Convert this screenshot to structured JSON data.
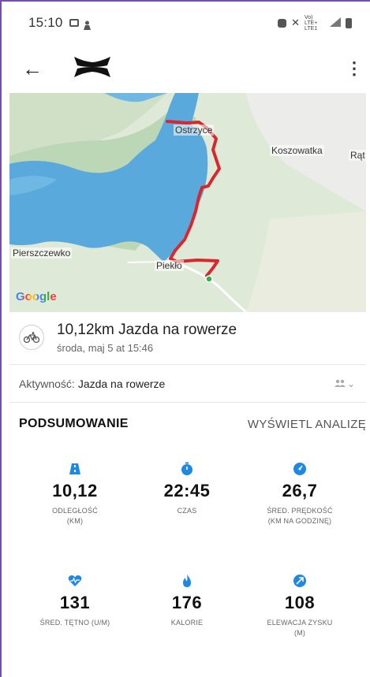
{
  "status_bar": {
    "time": "15:10",
    "network_label": "Vo) LTE+ LTE1"
  },
  "app_bar": {
    "back_glyph": "←",
    "menu_glyph": "⋮",
    "logo_name": "under-armour-logo"
  },
  "map": {
    "places": [
      "Ostrzyce",
      "Koszowatka",
      "Rąt",
      "Pierszczewko",
      "Piekło"
    ],
    "attribution": "Google",
    "route_color": "#d7282f",
    "water_color": "#5aa9dc"
  },
  "activity": {
    "title": "10,12km Jazda na rowerze",
    "date": "środa, maj 5 at 15:46",
    "type_label": "Aktywność:",
    "type_value": "Jazda na rowerze"
  },
  "summary": {
    "title": "PODSUMOWANIE",
    "analysis_link": "WYŚWIETL ANALIZĘ"
  },
  "stats": [
    {
      "icon": "road-icon",
      "value": "10,12",
      "label": "ODLEGŁOŚĆ\n(KM)"
    },
    {
      "icon": "stopwatch-icon",
      "value": "22:45",
      "label": "CZAS"
    },
    {
      "icon": "speedometer-icon",
      "value": "26,7",
      "label": "ŚRED. PRĘDKOŚĆ\n(KM NA GODZINĘ)"
    },
    {
      "icon": "heart-icon",
      "value": "131",
      "label": "ŚRED. TĘTNO (U/M)"
    },
    {
      "icon": "flame-icon",
      "value": "176",
      "label": "KALORIE"
    },
    {
      "icon": "elevation-icon",
      "value": "108",
      "label": "ELEWACJA ZYSKU\n(M)"
    }
  ],
  "accent_color": "#1e88e5"
}
